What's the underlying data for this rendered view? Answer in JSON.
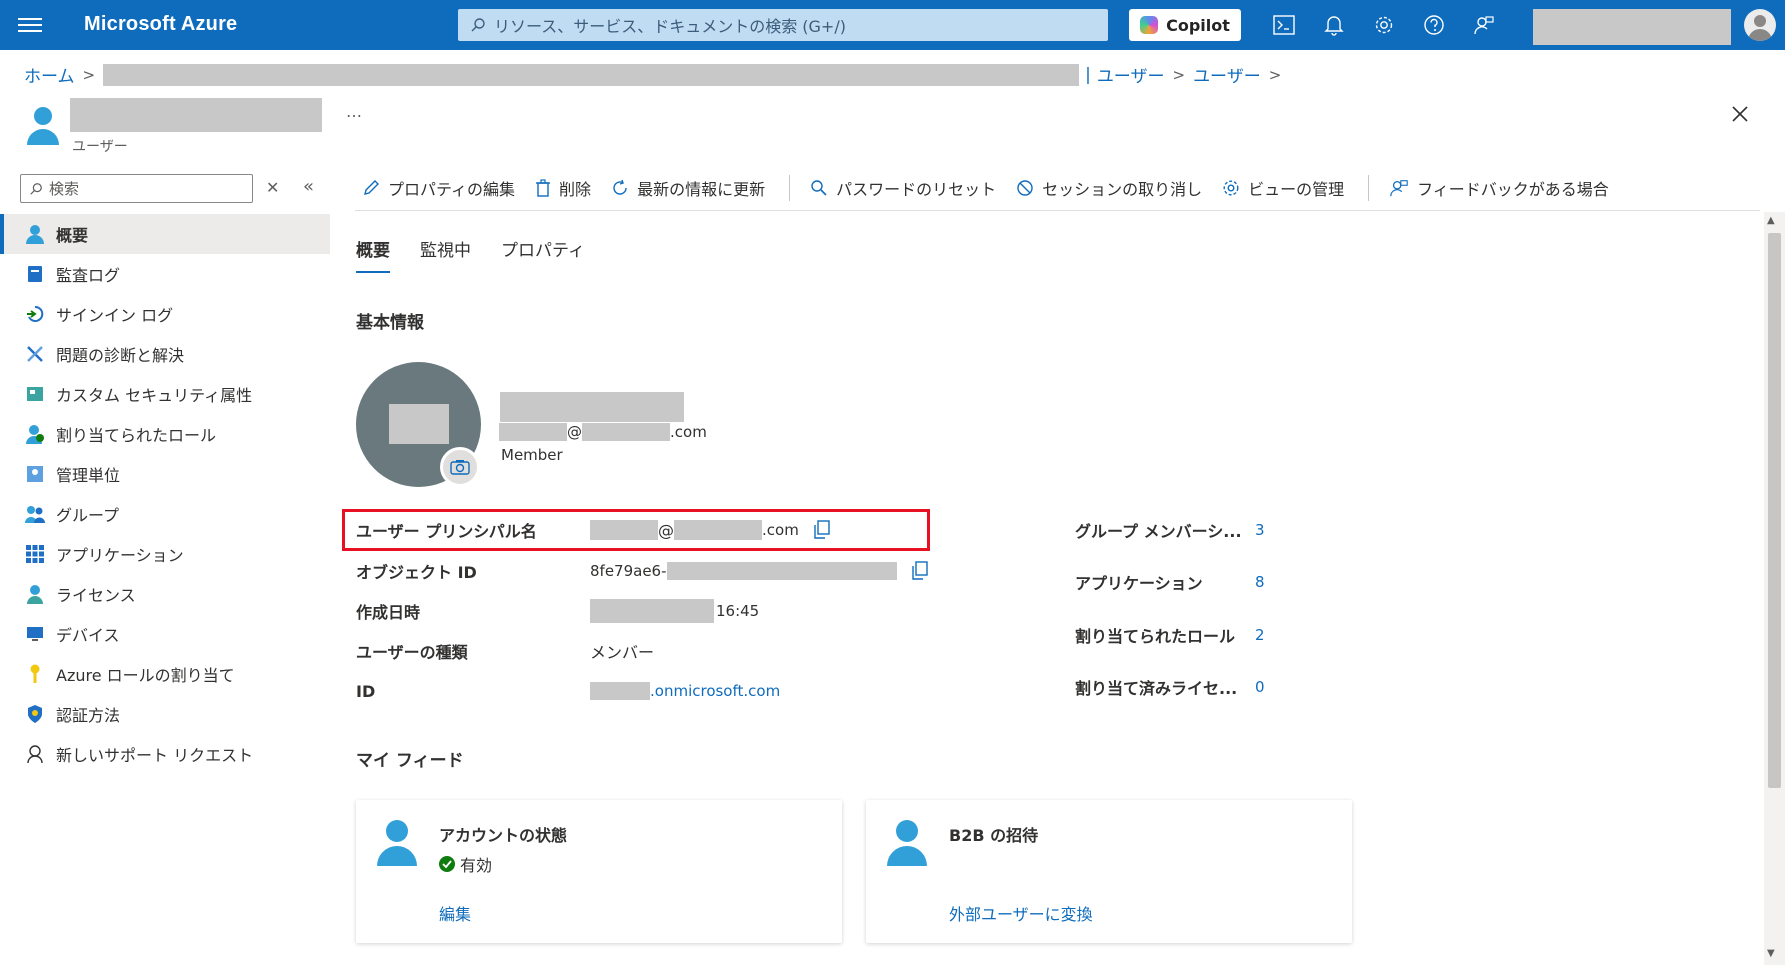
{
  "topbar": {
    "brand": "Microsoft Azure",
    "search_placeholder": "リソース、サービス、ドキュメントの検索 (G+/)",
    "copilot_label": "Copilot",
    "icons": [
      "cloud-shell-icon",
      "bell-icon",
      "gear-icon",
      "help-icon",
      "feedback-icon"
    ]
  },
  "breadcrumb": {
    "home": "ホーム",
    "items": [
      "ユーザー",
      "ユーザー"
    ]
  },
  "user_header": {
    "subtitle": "ユーザー",
    "more": "…"
  },
  "sidebar": {
    "search_placeholder": "検索",
    "items": [
      {
        "label": "概要",
        "icon": "user-icon",
        "active": true
      },
      {
        "label": "監査ログ",
        "icon": "audit-log-icon"
      },
      {
        "label": "サインイン ログ",
        "icon": "sign-in-icon"
      },
      {
        "label": "問題の診断と解決",
        "icon": "wrench-icon"
      },
      {
        "label": "カスタム セキュリティ属性",
        "icon": "security-attribute-icon"
      },
      {
        "label": "割り当てられたロール",
        "icon": "role-icon"
      },
      {
        "label": "管理単位",
        "icon": "admin-unit-icon"
      },
      {
        "label": "グループ",
        "icon": "group-icon"
      },
      {
        "label": "アプリケーション",
        "icon": "apps-grid-icon"
      },
      {
        "label": "ライセンス",
        "icon": "license-icon"
      },
      {
        "label": "デバイス",
        "icon": "device-icon"
      },
      {
        "label": "Azure ロールの割り当て",
        "icon": "key-icon"
      },
      {
        "label": "認証方法",
        "icon": "shield-icon"
      },
      {
        "label": "新しいサポート リクエスト",
        "icon": "support-icon"
      }
    ]
  },
  "toolbar": {
    "edit": "プロパティの編集",
    "delete": "削除",
    "refresh": "最新の情報に更新",
    "reset_password": "パスワードのリセット",
    "revoke_sessions": "セッションの取り消し",
    "manage_view": "ビューの管理",
    "feedback": "フィードバックがある場合"
  },
  "tabs": [
    "概要",
    "監視中",
    "プロパティ"
  ],
  "basic_info": {
    "title": "基本情報",
    "email_at": "@",
    "email_domain": ".com",
    "member_label": "Member"
  },
  "properties": {
    "upn": {
      "label": "ユーザー プリンシパル名",
      "at": "@",
      "domain": ".com"
    },
    "object_id": {
      "label": "オブジェクト ID",
      "prefix": "8fe79ae6-"
    },
    "created": {
      "label": "作成日時",
      "time": "16:45"
    },
    "user_type": {
      "label": "ユーザーの種類",
      "value": "メンバー"
    },
    "identity": {
      "label": "ID",
      "domain": ".onmicrosoft.com"
    }
  },
  "stats": [
    {
      "label": "グループ メンバーシ...",
      "value": "3"
    },
    {
      "label": "アプリケーション",
      "value": "8"
    },
    {
      "label": "割り当てられたロール",
      "value": "2"
    },
    {
      "label": "割り当て済みライセ...",
      "value": "0"
    }
  ],
  "my_feed": {
    "title": "マイ フィード",
    "cards": [
      {
        "title": "アカウントの状態",
        "status": "有効",
        "link": "編集"
      },
      {
        "title": "B2B の招待",
        "link": "外部ユーザーに変換"
      }
    ]
  },
  "colors": {
    "accent": "#0f6cbd",
    "highlight": "#e81123",
    "success": "#107c10"
  }
}
